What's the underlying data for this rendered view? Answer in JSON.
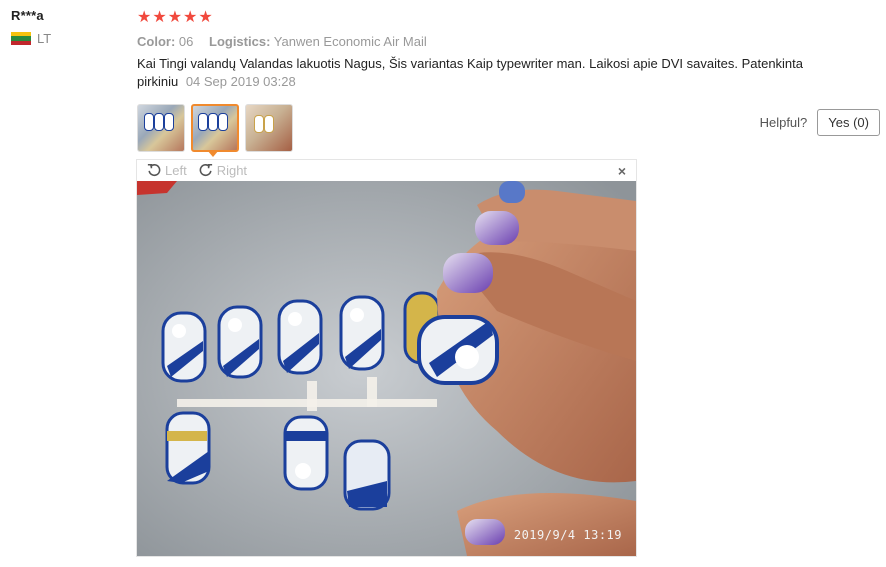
{
  "reviewer": {
    "name": "R***a",
    "country": "LT"
  },
  "rating": 5,
  "meta": {
    "color_label": "Color:",
    "color_value": "06",
    "logistics_label": "Logistics:",
    "logistics_value": "Yanwen Economic Air Mail"
  },
  "review": {
    "text": "Kai Tingi valandų Valandas lakuotis Nagus, Šis variantas Kaip typewriter man. Laikosi apie DVI savaites. Patenkinta pirkiniu",
    "date": "04 Sep 2019 03:28"
  },
  "helpful": {
    "label": "Helpful?",
    "yes_label": "Yes (0)"
  },
  "viewer": {
    "left_label": "Left",
    "right_label": "Right",
    "close_glyph": "×",
    "timestamp": "2019/9/4  13:19"
  },
  "colors": {
    "star": "#f1493d",
    "active_thumb": "#f08a2e",
    "nail_blue": "#1b3f9c"
  }
}
